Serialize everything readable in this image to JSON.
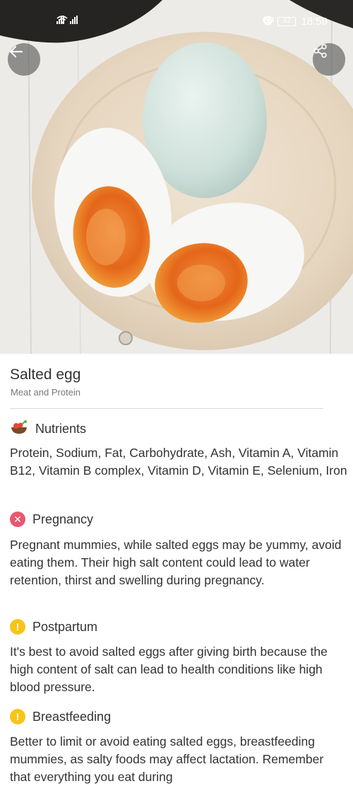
{
  "status_bar": {
    "time": "18:59",
    "battery": "42"
  },
  "header": {
    "back_icon": "arrow-left-icon",
    "share_icon": "share-icon"
  },
  "food": {
    "name": "Salted egg",
    "category": "Meat and Protein"
  },
  "sections": {
    "nutrients": {
      "icon": "food-bowl-icon",
      "title": "Nutrients",
      "body": "Protein, Sodium, Fat, Carbohydrate, Ash, Vitamin A, Vitamin B12, Vitamin B complex, Vitamin D, Vitamin E, Selenium, Iron"
    },
    "pregnancy": {
      "icon": "x-circle-icon",
      "status_color": "#e8586e",
      "title": "Pregnancy",
      "body": "Pregnant mummies, while salted eggs may be yummy, avoid eating them. Their high salt content could lead to water retention, thirst and swelling during pregnancy."
    },
    "postpartum": {
      "icon": "exclamation-circle-icon",
      "status_color": "#f5c519",
      "title": "Postpartum",
      "body": "It's best to avoid salted eggs after giving birth because the high content of salt can lead to health conditions like high blood pressure."
    },
    "breastfeeding": {
      "icon": "exclamation-circle-icon",
      "status_color": "#f5c519",
      "title": "Breastfeeding",
      "body": "Better to limit or avoid eating salted eggs, breastfeeding mummies, as salty foods may affect lactation. Remember that everything you eat during"
    }
  }
}
